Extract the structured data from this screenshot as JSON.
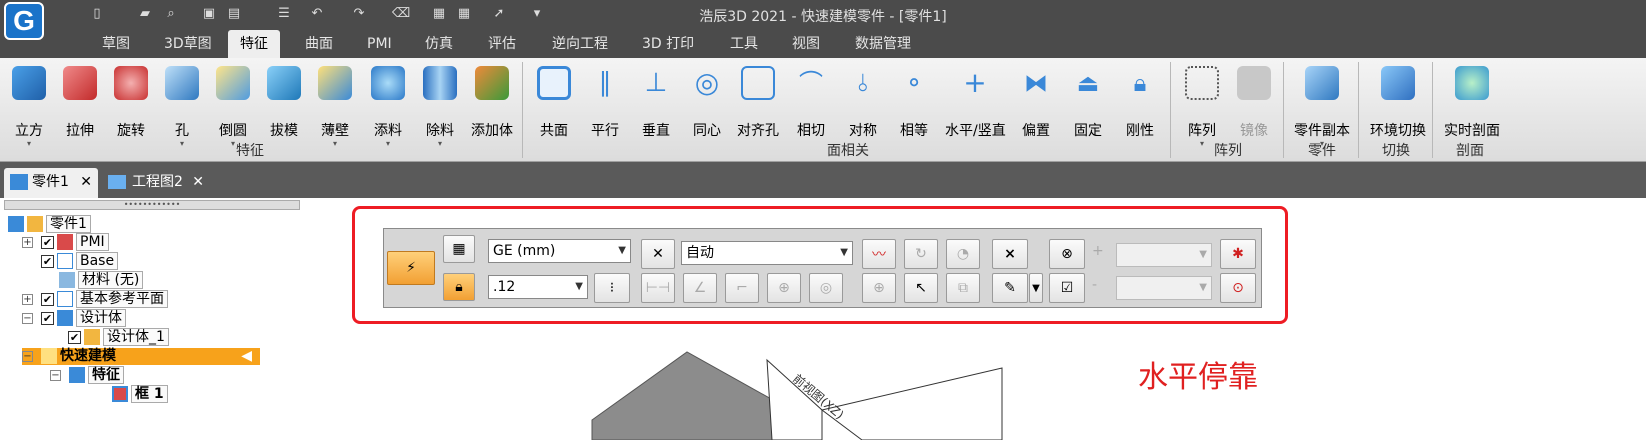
{
  "window": {
    "title": "浩辰3D 2021 - 快速建模零件 - [零件1]",
    "logo": "G"
  },
  "ribbon_tabs": [
    "草图",
    "3D草图",
    "特征",
    "曲面",
    "PMI",
    "仿真",
    "评估",
    "逆向工程",
    "3D 打印",
    "工具",
    "视图",
    "数据管理"
  ],
  "active_tab": "特征",
  "ribbon": {
    "buttons": [
      "立方",
      "拉伸",
      "旋转",
      "孔",
      "倒圆",
      "拔模",
      "薄壁",
      "添料",
      "除料",
      "添加体",
      "共面",
      "平行",
      "垂直",
      "同心",
      "对齐孔",
      "相切",
      "对称",
      "相等",
      "水平/竖直",
      "偏置",
      "固定",
      "刚性",
      "阵列",
      "镜像",
      "零件副本",
      "环境切换",
      "实时剖面"
    ],
    "groups": [
      "特征",
      "面相关",
      "阵列",
      "零件",
      "切换",
      "剖面"
    ]
  },
  "doc_tabs": [
    {
      "label": "零件1"
    },
    {
      "label": "工程图2"
    }
  ],
  "tree": {
    "root": "零件1",
    "pmi": "PMI",
    "base": "Base",
    "material": "材料 (无)",
    "refplanes": "基本参考平面",
    "design": "设计体",
    "design_child": "设计体_1",
    "fast": "快速建模",
    "feature": "特征",
    "frame": "框 1"
  },
  "panel": {
    "standard": "GE (mm)",
    "precision": ".12",
    "mode": "自动",
    "plus": "+",
    "minus": "-"
  },
  "viewport": {
    "view_label": "前视图(XZ)"
  },
  "caption": "水平停靠",
  "colors": {
    "accent": "#ee1c24",
    "highlight": "#f7a21b",
    "titlebar": "#4b4b4b"
  },
  "icons": [
    "lightning-icon",
    "lock-icon",
    "close-icon"
  ]
}
